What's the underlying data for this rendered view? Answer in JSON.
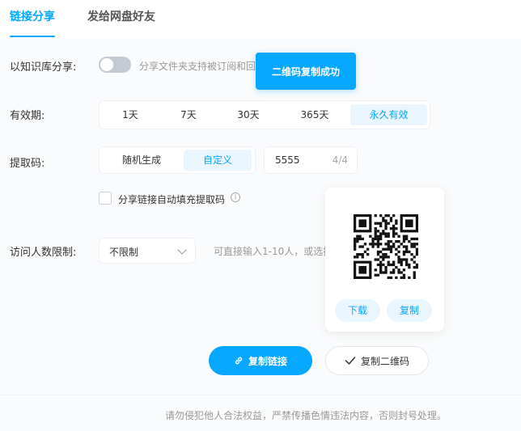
{
  "tabs": [
    {
      "label": "链接分享",
      "active": true
    },
    {
      "label": "发给网盘好友",
      "active": false
    }
  ],
  "knowledge": {
    "label": "以知识库分享:",
    "enabled": false,
    "hint": "分享文件夹支持被订阅和回"
  },
  "toast": {
    "text": "二维码复制成功"
  },
  "validity": {
    "label": "有效期:",
    "options": [
      "1天",
      "7天",
      "30天",
      "365天",
      "永久有效"
    ],
    "selected": "永久有效"
  },
  "extract_code": {
    "label": "提取码:",
    "options": [
      "随机生成",
      "自定义"
    ],
    "selected": "自定义",
    "value": "5555",
    "count": "4/4"
  },
  "autofill": {
    "label": "分享链接自动填充提取码",
    "checked": false,
    "info_icon": "info-circle-icon"
  },
  "visitor_limit": {
    "label": "访问人数限制:",
    "value": "不限制",
    "hint": "可直接输入1-10人，或选择"
  },
  "qr_card": {
    "download_label": "下载",
    "copy_label": "复制"
  },
  "actions": {
    "copy_link_label": "复制链接",
    "copy_link_icon": "link-icon",
    "copy_qr_label": "复制二维码",
    "copy_qr_icon": "check-icon"
  },
  "footer": {
    "text": "请勿侵犯他人合法权益，严禁传播色情违法内容，否则封号处理。"
  },
  "colors": {
    "accent": "#06a7ff",
    "accent_light": "#eaf6ff",
    "muted": "#999999"
  }
}
